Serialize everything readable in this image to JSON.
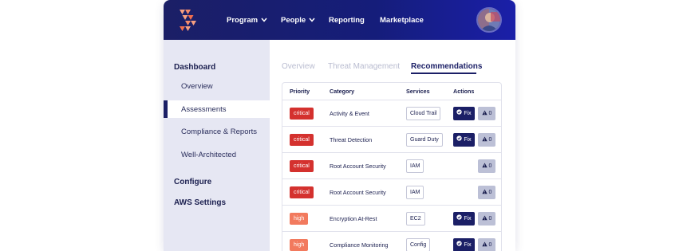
{
  "colors": {
    "brand_navy": "#1b1f66",
    "critical": "#d4312e",
    "high": "#f27a5e",
    "sidebar_bg": "#e6e7f3"
  },
  "header": {
    "logo_icon": "brand-logo-icon",
    "nav": [
      {
        "label": "Program",
        "has_dropdown": true
      },
      {
        "label": "People",
        "has_dropdown": true
      },
      {
        "label": "Reporting",
        "has_dropdown": false
      },
      {
        "label": "Marketplace",
        "has_dropdown": false
      }
    ],
    "avatar_icon": "user-avatar"
  },
  "sidebar": {
    "sections": [
      {
        "label": "Dashboard",
        "items": [
          {
            "label": "Overview",
            "active": false
          },
          {
            "label": "Assessments",
            "active": true
          },
          {
            "label": "Compliance & Reports",
            "active": false
          },
          {
            "label": "Well-Architected",
            "active": false
          }
        ]
      },
      {
        "label": "Configure",
        "items": []
      },
      {
        "label": "AWS Settings",
        "items": []
      }
    ]
  },
  "tabs": [
    {
      "label": "Overview",
      "active": false
    },
    {
      "label": "Threat Management",
      "active": false
    },
    {
      "label": "Recommendations",
      "active": true
    }
  ],
  "table": {
    "columns": [
      "Priority",
      "Category",
      "Services",
      "Actions"
    ],
    "fix_label": "Fix",
    "rows": [
      {
        "priority": "critical",
        "category": "Activity & Event",
        "service": "Cloud Trail",
        "fix": true,
        "alerts": "0"
      },
      {
        "priority": "critical",
        "category": "Threat Detection",
        "service": "Guard Duty",
        "fix": true,
        "alerts": "0"
      },
      {
        "priority": "critical",
        "category": "Root Account Security",
        "service": "IAM",
        "fix": false,
        "alerts": "0"
      },
      {
        "priority": "critical",
        "category": "Root Account Security",
        "service": "IAM",
        "fix": false,
        "alerts": "0"
      },
      {
        "priority": "high",
        "category": "Encryption At-Rest",
        "service": "EC2",
        "fix": true,
        "alerts": "0"
      },
      {
        "priority": "high",
        "category": "Compliance Monitoring",
        "service": "Config",
        "fix": true,
        "alerts": "0"
      }
    ]
  }
}
